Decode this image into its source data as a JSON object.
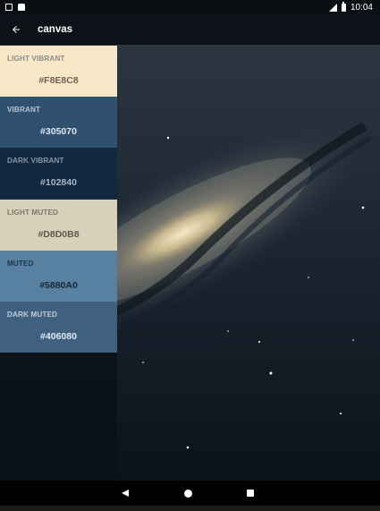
{
  "status_bar": {
    "time": "10:04",
    "left_icons": [
      "notification-icon",
      "android-icon"
    ],
    "right_icons": [
      "signal-icon",
      "battery-icon"
    ]
  },
  "toolbar": {
    "back_icon": "arrow-back-icon",
    "title": "canvas"
  },
  "palette": [
    {
      "name": "LIGHT VIBRANT",
      "hex": "#F8E8C8",
      "bg": "#F8E8C8",
      "name_color": "#8a8a8a",
      "hex_color": "#6c6458"
    },
    {
      "name": "VIBRANT",
      "hex": "#305070",
      "bg": "#305070",
      "name_color": "#b8c3d0",
      "hex_color": "#dfe6ee"
    },
    {
      "name": "DARK VIBRANT",
      "hex": "#102840",
      "bg": "#102840",
      "name_color": "#8894a3",
      "hex_color": "#a9b6c6"
    },
    {
      "name": "LIGHT MUTED",
      "hex": "#D8D0B8",
      "bg": "#D8D0B8",
      "name_color": "#7b7870",
      "hex_color": "#5d594e"
    },
    {
      "name": "MUTED",
      "hex": "#5880A0",
      "bg": "#5880A0",
      "name_color": "#1f3447",
      "hex_color": "#172838"
    },
    {
      "name": "DARK MUTED",
      "hex": "#406080",
      "bg": "#406080",
      "name_color": "#bfcad6",
      "hex_color": "#e3e9ef"
    }
  ],
  "nav_bar": {
    "icons": [
      "back-triangle-icon",
      "home-circle-icon",
      "recents-square-icon"
    ]
  }
}
